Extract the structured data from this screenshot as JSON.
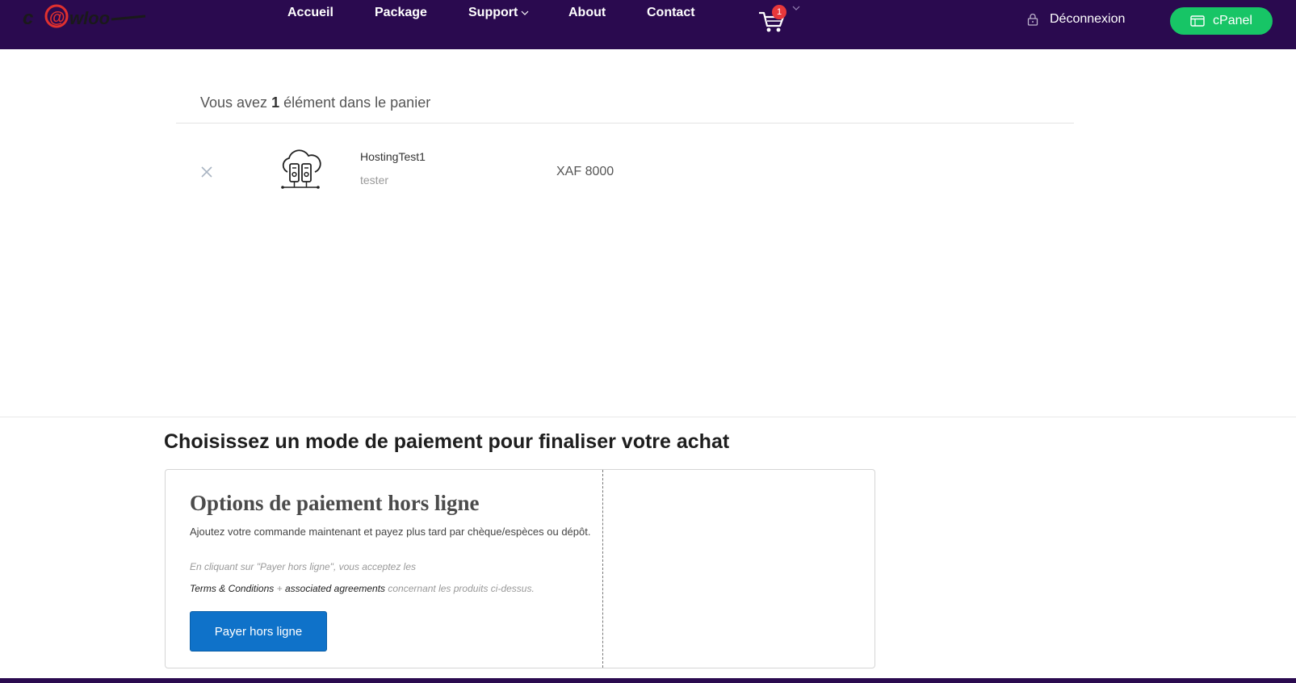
{
  "header": {
    "brand": "c@wloo",
    "nav": {
      "home": "Accueil",
      "package": "Package",
      "support": "Support",
      "about": "About",
      "contact": "Contact"
    },
    "cart_count": "1",
    "logout": "Déconnexion",
    "cpanel": "cPanel"
  },
  "cart": {
    "summary_prefix": "Vous avez ",
    "summary_count": "1",
    "summary_suffix": " élément dans le panier",
    "items": [
      {
        "name": "HostingTest1",
        "subtitle": "tester",
        "price": "XAF 8000"
      }
    ]
  },
  "payment": {
    "heading": "Choisissez un mode de paiement pour finaliser votre achat",
    "offline_title": "Options de paiement hors ligne",
    "offline_desc": "Ajoutez votre commande maintenant et payez plus tard par chèque/espèces ou dépôt.",
    "consent": "En cliquant sur \"Payer hors ligne\", vous acceptez les",
    "terms_link": "Terms & Conditions",
    "terms_plus": " + ",
    "agreements_link": "associated agreements",
    "terms_suffix": " concernant les produits ci-dessus.",
    "button": "Payer hors ligne"
  },
  "colors": {
    "header_bg": "#2a0a4f",
    "cpanel_green": "#17c566",
    "pay_button_blue": "#0f72c9",
    "badge_red": "#e8383b"
  }
}
